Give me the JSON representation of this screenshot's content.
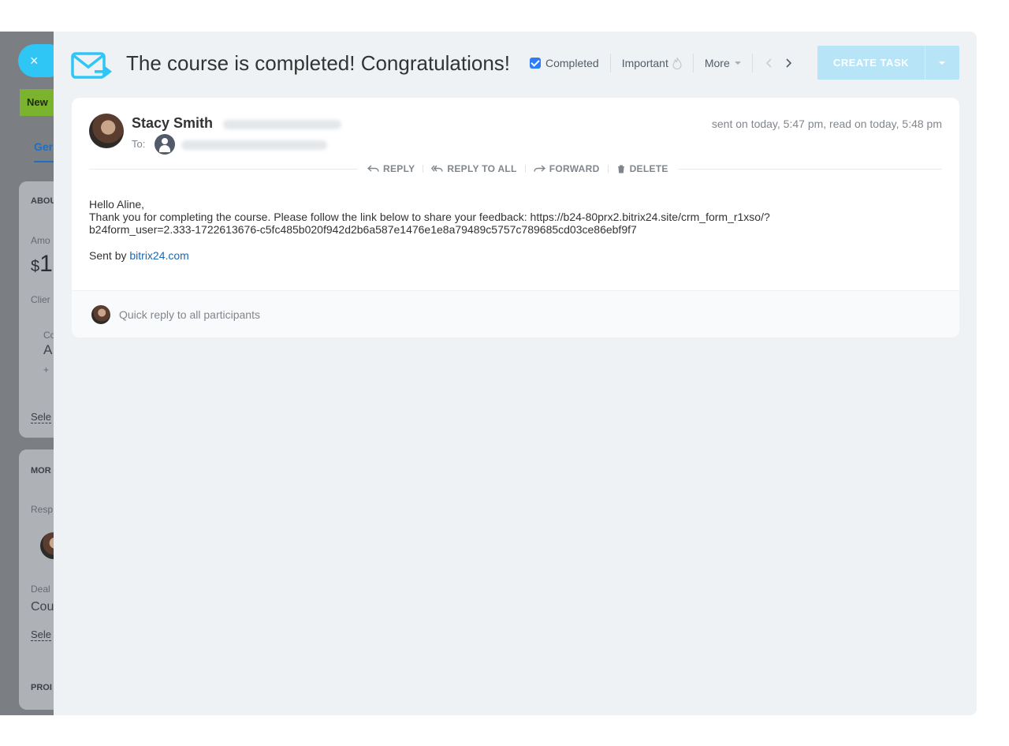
{
  "background": {
    "close_label": "×",
    "new_tag": "New",
    "tab_label": "Ger",
    "about_label": "ABOU",
    "amount_label": "Amo",
    "amount_currency": "$",
    "amount_value": "1",
    "client_label": "Clier",
    "contact_label": "Co",
    "contact_initial": "A",
    "contact_phone": "+",
    "select_link": "Sele",
    "more_label": "MOR",
    "responsible_label": "Resp",
    "deal_label": "Deal",
    "deal_value": "Cou",
    "select_link_2": "Sele",
    "products_label": "PROI"
  },
  "header": {
    "title": "The course is completed! Congratulations!",
    "completed_label": "Completed",
    "completed_checked": true,
    "important_label": "Important",
    "more_label": "More",
    "create_task_label": "CREATE TASK"
  },
  "email": {
    "sender_name": "Stacy Smith",
    "sent_info": "sent on today, 5:47 pm, read on today, 5:48 pm",
    "to_label": "To:",
    "actions": {
      "reply": "REPLY",
      "reply_all": "REPLY TO ALL",
      "forward": "FORWARD",
      "delete": "DELETE"
    },
    "greeting": "Hello Aline,",
    "line1": "Thank you for completing the course. Please follow the link below to share your feedback: https://b24-80prx2.bitrix24.site/crm_form_r1xso/?",
    "line2": "b24form_user=2.333-1722613676-c5fc485b020f942d2b6a587e1476e1e8a79489c5757c789685cd03ce86ebf9f7",
    "sent_by_prefix": "Sent by ",
    "sent_by_link": "bitrix24.com"
  },
  "quick_reply": {
    "placeholder": "Quick reply to all participants"
  },
  "colors": {
    "accent": "#2fc6f6",
    "checkbox": "#2e7cf6",
    "link": "#2067b0",
    "create_task_bg": "#b7e4f6"
  },
  "icons": {
    "header": "mail-forward-icon",
    "important": "flame-icon",
    "prev": "chevron-left-icon",
    "next": "chevron-right-icon"
  }
}
